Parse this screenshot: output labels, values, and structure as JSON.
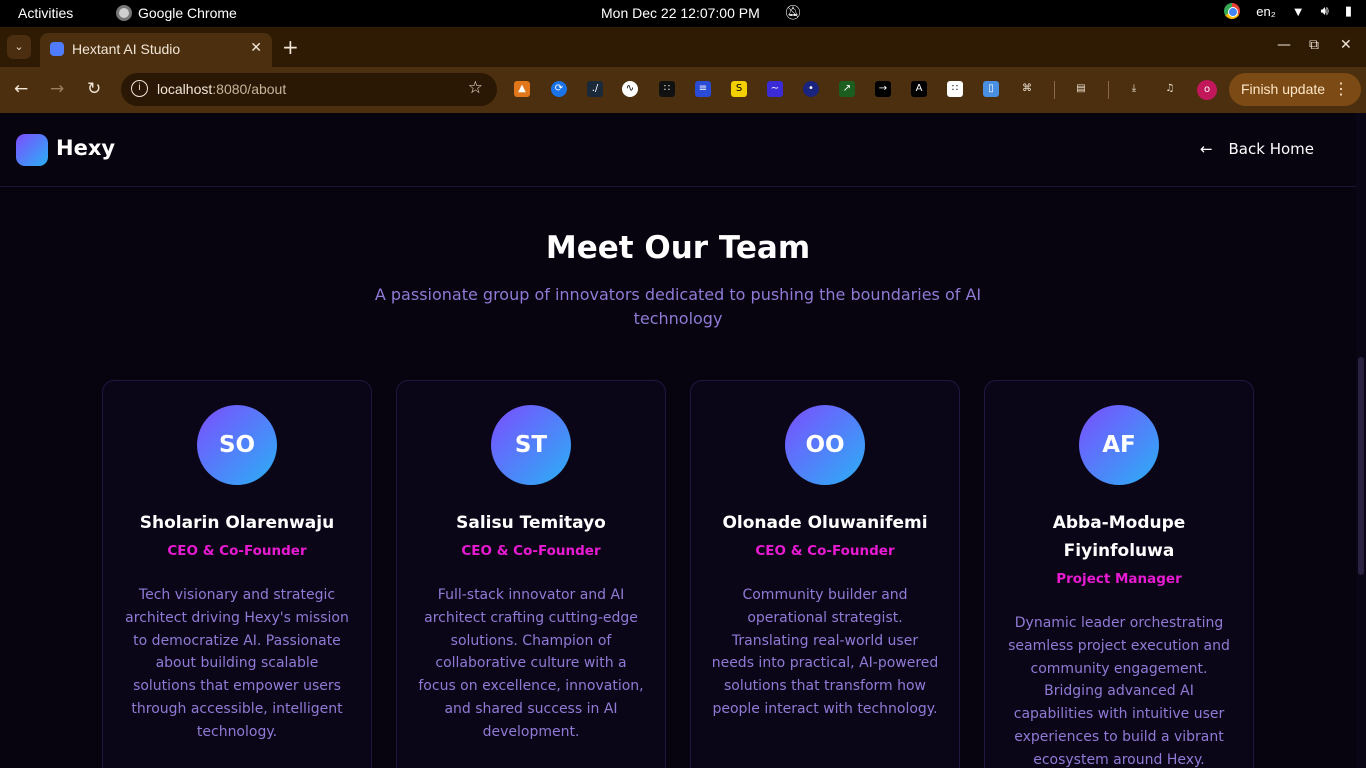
{
  "system": {
    "activities": "Activities",
    "app_name": "Google Chrome",
    "clock": "Mon Dec 22  12:07:00 PM",
    "lang": "en₂"
  },
  "browser": {
    "tab_title": "Hextant AI Studio",
    "url_host": "localhost",
    "url_rest": ":8080/about",
    "finish_update": "Finish update",
    "profile_initial": "o"
  },
  "site": {
    "brand": "Hexy",
    "back_home": "Back Home"
  },
  "team": {
    "heading": "Meet Our Team",
    "subheading": "A passionate group of innovators dedicated to pushing the boundaries of AI technology",
    "members": [
      {
        "initials": "SO",
        "name": "Sholarin Olarenwaju",
        "role": "CEO & Co-Founder",
        "bio": "Tech visionary and strategic architect driving Hexy's mission to democratize AI. Passionate about building scalable solutions that empower users through accessible, intelligent technology."
      },
      {
        "initials": "ST",
        "name": "Salisu Temitayo",
        "role": "CEO & Co-Founder",
        "bio": "Full-stack innovator and AI architect crafting cutting-edge solutions. Champion of collaborative culture with a focus on excellence, innovation, and shared success in AI development."
      },
      {
        "initials": "OO",
        "name": "Olonade Oluwanifemi",
        "role": "CEO & Co-Founder",
        "bio": "Community builder and operational strategist. Translating real-world user needs into practical, AI-powered solutions that transform how people interact with technology."
      },
      {
        "initials": "AF",
        "name": "Abba-Modupe Fiyinfoluwa",
        "role": "Project Manager",
        "bio": "Dynamic leader orchestrating seamless project execution and community engagement. Bridging advanced AI capabilities with intuitive user experiences to build a vibrant ecosystem around Hexy."
      }
    ]
  },
  "colors": {
    "accent_pink": "#e81ad2",
    "muted_purple": "#8f7bd6",
    "gradient_start": "#7c4dff",
    "gradient_end": "#2ab0f5"
  }
}
